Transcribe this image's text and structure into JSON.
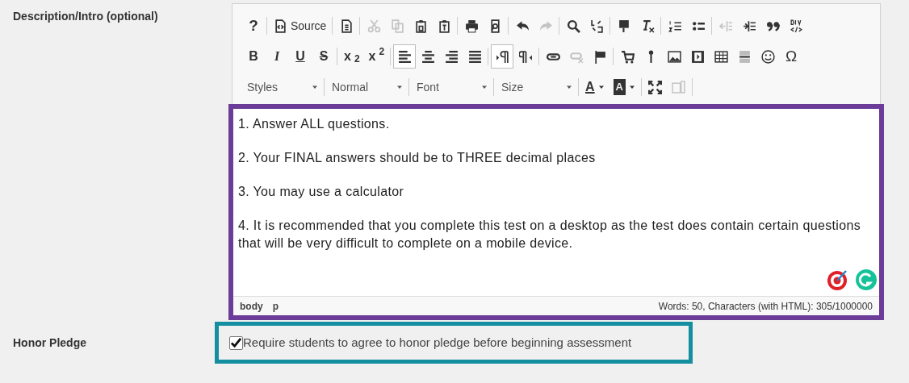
{
  "description_label": "Description/Intro (optional)",
  "editor": {
    "toolbar": [
      [
        {
          "kind": "button",
          "text": "?",
          "disabled": false,
          "selected": false
        },
        {
          "kind": "sep"
        },
        {
          "kind": "icon_text",
          "text": "Source",
          "disabled": false,
          "selected": false
        },
        {
          "kind": "sep"
        },
        {
          "kind": "icon",
          "disabled": false,
          "selected": false
        },
        {
          "kind": "sep"
        },
        {
          "kind": "icon",
          "disabled": true,
          "selected": false
        },
        {
          "kind": "icon",
          "disabled": true,
          "selected": false
        },
        {
          "kind": "icon",
          "disabled": false,
          "selected": false
        },
        {
          "kind": "icon",
          "disabled": false,
          "selected": false
        },
        {
          "kind": "sep"
        },
        {
          "kind": "icon",
          "disabled": false,
          "selected": false
        },
        {
          "kind": "icon",
          "disabled": false,
          "selected": false
        },
        {
          "kind": "sep"
        },
        {
          "kind": "icon",
          "disabled": false,
          "selected": false
        },
        {
          "kind": "icon",
          "disabled": true,
          "selected": false
        },
        {
          "kind": "sep"
        },
        {
          "kind": "icon",
          "disabled": false,
          "selected": false
        },
        {
          "kind": "icon",
          "disabled": false,
          "selected": false
        },
        {
          "kind": "sep"
        },
        {
          "kind": "icon",
          "disabled": false,
          "selected": false
        },
        {
          "kind": "icon",
          "disabled": false,
          "selected": false
        },
        {
          "kind": "sep"
        },
        {
          "kind": "icon",
          "disabled": false,
          "selected": false
        },
        {
          "kind": "icon",
          "disabled": false,
          "selected": false
        },
        {
          "kind": "sep"
        },
        {
          "kind": "icon",
          "disabled": true,
          "selected": false
        },
        {
          "kind": "icon",
          "disabled": false,
          "selected": false
        },
        {
          "kind": "icon",
          "disabled": false,
          "selected": false
        },
        {
          "kind": "icon",
          "disabled": false,
          "selected": false
        }
      ],
      [
        {
          "kind": "button",
          "text": "B",
          "disabled": false,
          "selected": false
        },
        {
          "kind": "button",
          "text": "I",
          "disabled": false,
          "selected": false
        },
        {
          "kind": "button",
          "text": "U",
          "disabled": false,
          "selected": false
        },
        {
          "kind": "button",
          "text": "S",
          "disabled": false,
          "selected": false
        },
        {
          "kind": "sep"
        },
        {
          "kind": "button",
          "text": "x$_{2}$",
          "disabled": false,
          "selected": false
        },
        {
          "kind": "button",
          "text": "x$^{2}$",
          "disabled": false,
          "selected": false
        },
        {
          "kind": "sep"
        },
        {
          "kind": "icon",
          "disabled": false,
          "selected": true
        },
        {
          "kind": "icon",
          "disabled": false,
          "selected": false
        },
        {
          "kind": "icon",
          "disabled": false,
          "selected": false
        },
        {
          "kind": "icon",
          "disabled": false,
          "selected": false
        },
        {
          "kind": "sep"
        },
        {
          "kind": "icon",
          "disabled": false,
          "selected": true
        },
        {
          "kind": "icon",
          "disabled": false,
          "selected": false
        },
        {
          "kind": "sep"
        },
        {
          "kind": "icon",
          "disabled": false,
          "selected": false
        },
        {
          "kind": "icon",
          "disabled": true,
          "selected": false
        },
        {
          "kind": "icon",
          "disabled": false,
          "selected": false
        },
        {
          "kind": "sep"
        },
        {
          "kind": "icon",
          "disabled": false,
          "selected": false
        },
        {
          "kind": "icon",
          "disabled": false,
          "selected": false
        },
        {
          "kind": "icon",
          "disabled": false,
          "selected": false
        },
        {
          "kind": "icon",
          "disabled": false,
          "selected": false
        },
        {
          "kind": "icon",
          "disabled": false,
          "selected": false
        },
        {
          "kind": "icon",
          "disabled": false,
          "selected": false
        },
        {
          "kind": "icon",
          "disabled": false,
          "selected": false
        },
        {
          "kind": "button",
          "text": "Ω",
          "disabled": false,
          "selected": false
        }
      ],
      [
        {
          "kind": "combo",
          "text": "Styles"
        },
        {
          "kind": "sep"
        },
        {
          "kind": "combo",
          "text": "Normal"
        },
        {
          "kind": "sep"
        },
        {
          "kind": "combo",
          "text": "Font"
        },
        {
          "kind": "sep"
        },
        {
          "kind": "combo",
          "text": "Size"
        },
        {
          "kind": "sep"
        },
        {
          "kind": "textcolor",
          "text": "A"
        },
        {
          "kind": "bgcolor",
          "text": "A"
        },
        {
          "kind": "sep"
        },
        {
          "kind": "icon",
          "disabled": false,
          "selected": false
        },
        {
          "kind": "icon",
          "disabled": true,
          "selected": false
        },
        {
          "kind": "sep"
        }
      ]
    ],
    "paragraphs": [
      "1. Answer ALL questions.",
      "2. Your FINAL answers should be to THREE decimal places",
      "3. You may use a calculator",
      "4. It is recommended that you complete this test on a desktop as the test does contain certain questions that will be very difficult to complete on a mobile device."
    ],
    "path": [
      "body",
      "p"
    ],
    "word_count": "Words: 50, Characters (with HTML): 305/1000000"
  },
  "honor": {
    "label": "Honor Pledge",
    "checkbox_label": "Require students to agree to honor pledge before beginning assessment",
    "checked": true
  }
}
